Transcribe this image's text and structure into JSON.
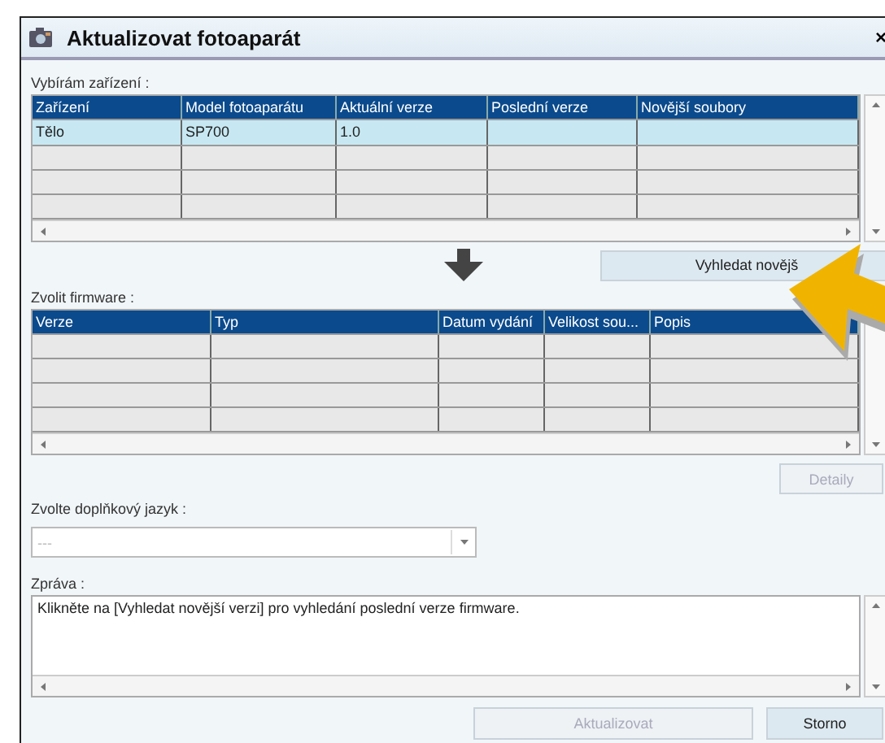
{
  "window": {
    "title": "Aktualizovat fotoaparát",
    "close": "×"
  },
  "devices": {
    "label": "Vybírám zařízení :",
    "columns": [
      "Zařízení",
      "Model fotoaparátu",
      "Aktuální verze",
      "Poslední verze",
      "Novější soubory"
    ],
    "rows": [
      {
        "cells": [
          "Tělo",
          "SP700",
          "1.0"
        ],
        "selected": true
      }
    ]
  },
  "search_button": {
    "label": "Vyhledat novějš"
  },
  "firmware": {
    "label": "Zvolit firmware :",
    "columns": [
      "Verze",
      "Typ",
      "Datum vydání",
      "Velikost sou...",
      "Popis"
    ]
  },
  "details_button": {
    "label": "Detaily",
    "disabled": true
  },
  "language": {
    "label": "Zvolte doplňkový jazyk :",
    "value": "---",
    "disabled": true
  },
  "message": {
    "label": "Zpráva :",
    "text": "Klikněte na [Vyhledat novější verzi] pro vyhledání poslední verze firmware."
  },
  "buttons": [
    {
      "label": "Aktualizovat",
      "disabled": true
    },
    {
      "label": "Storno",
      "disabled": false
    }
  ]
}
